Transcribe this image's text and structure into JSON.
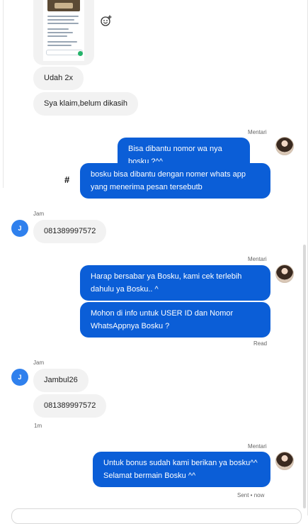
{
  "incoming_1": {
    "messages": [
      "Udah 2x",
      "Sya klaim,belum dikasih"
    ]
  },
  "outgoing_1": {
    "sender": "Mentari",
    "messages": [
      "Bisa dibantu nomor wa nya bosku ?^^",
      "bosku bisa dibantu dengan nomer whats app yang menerima pesan tersebutb"
    ],
    "hash_symbol": "#"
  },
  "incoming_2": {
    "sender": "Jam",
    "avatar_initial": "J",
    "messages": [
      "081389997572"
    ]
  },
  "outgoing_2": {
    "sender": "Mentari",
    "messages": [
      "Harap bersabar ya Bosku, kami cek terlebih dahulu ya Bosku.. ^",
      "Mohon di info untuk USER ID dan Nomor WhatsAppnya Bosku ?"
    ],
    "status": "Read"
  },
  "incoming_3": {
    "sender": "Jam",
    "avatar_initial": "J",
    "messages": [
      "Jambul26",
      "081389997572"
    ],
    "time": "1m"
  },
  "outgoing_3": {
    "sender": "Mentari",
    "messages": [
      "Untuk bonus sudah kami berikan ya bosku^^ Selamat bermain Bosku ^^"
    ],
    "status": "Sent • now"
  },
  "icons": {
    "react": "add-reaction-icon"
  },
  "colors": {
    "outgoing_bubble": "#0b5ed7",
    "incoming_bubble": "#f2f2f2",
    "avatar_j": "#2f80ed"
  }
}
